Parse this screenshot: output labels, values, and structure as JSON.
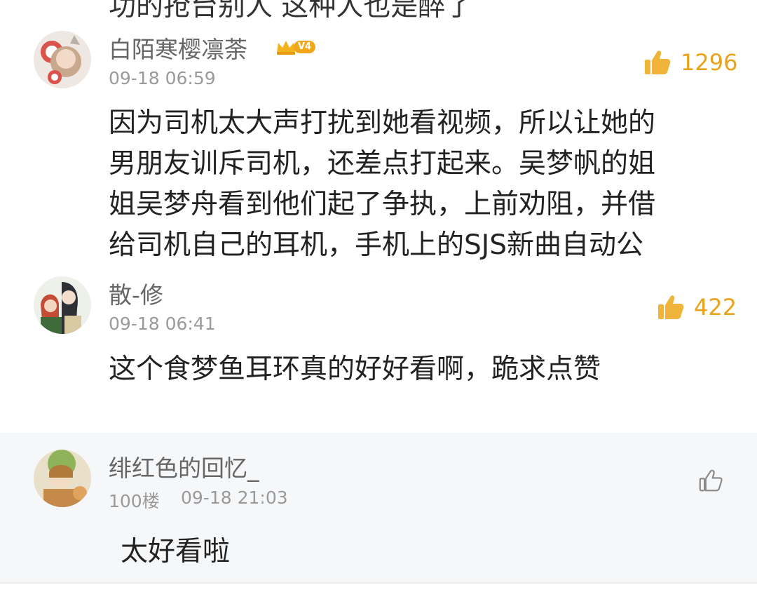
{
  "truncated_text": "功的抢台别人 这种人也是醉了",
  "comments": [
    {
      "username": "白陌寒樱凛荼",
      "badge": "V4",
      "timestamp": "09-18 06:59",
      "likes": "1296",
      "text": "因为司机太大声打扰到她看视频，所以让她的\n男朋友训斥司机，还差点打起来。吴梦帆的姐\n姐吴梦舟看到他们起了争执，上前劝阻，并借\n给司机自己的耳机，手机上的SJS新曲自动公",
      "like_icon": "thumbs-up-filled",
      "like_color": "#f0b43a"
    },
    {
      "username": "散-修",
      "timestamp": "09-18 06:41",
      "likes": "422",
      "text": "这个食梦鱼耳环真的好好看啊，跪求点赞",
      "like_icon": "thumbs-up-filled",
      "like_color": "#f0b43a"
    },
    {
      "username": "绯红色的回忆_",
      "floor": "100楼",
      "timestamp": "09-18 21:03",
      "text": "太好看啦",
      "like_icon": "thumbs-up-outline",
      "like_color": "#888888"
    }
  ],
  "colors": {
    "accent": "#f0b43a",
    "like_count": "#e8a31a",
    "reply_background": "#f6f7f9"
  }
}
